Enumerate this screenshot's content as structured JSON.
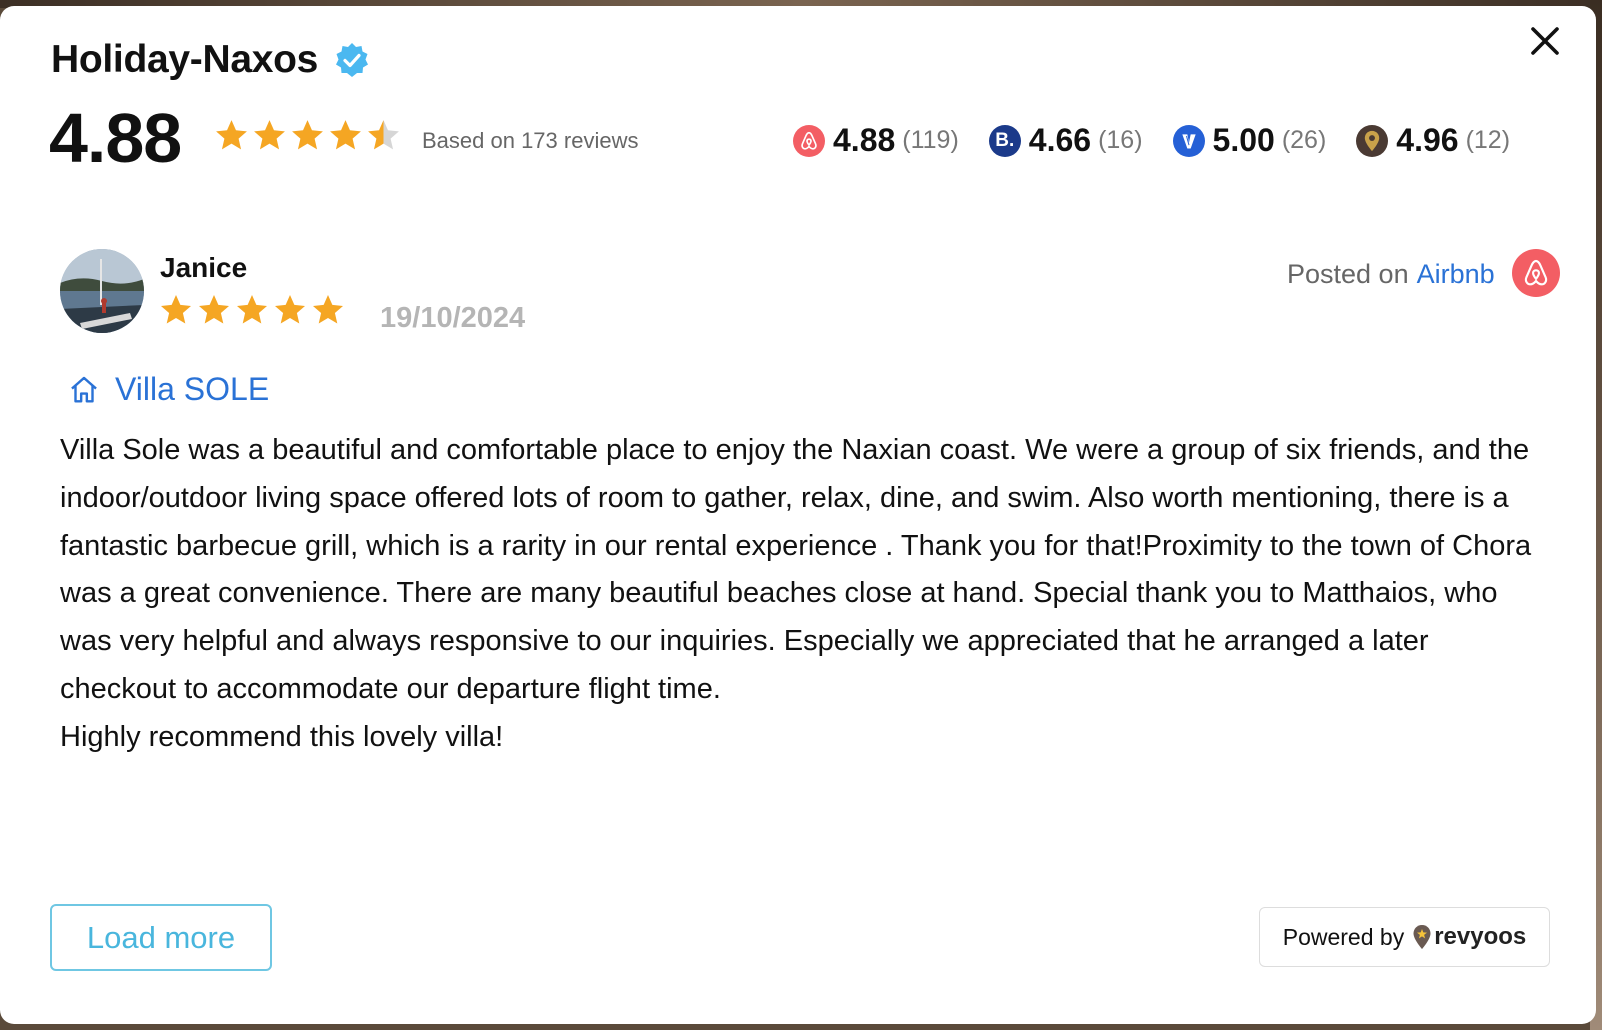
{
  "widget": {
    "title": "Holiday-Naxos",
    "verified_icon": "verified-badge-icon",
    "close_icon": "close-icon",
    "overall_rating": "4.88",
    "overall_stars": 4.88,
    "based_on": "Based on 173 reviews"
  },
  "platforms": [
    {
      "name": "airbnb",
      "icon": "airbnb-icon",
      "score": "4.88",
      "count": "(119)",
      "color": "#f35e64"
    },
    {
      "name": "booking",
      "icon": "booking-icon",
      "score": "4.66",
      "count": "(16)",
      "color": "#1b3a8a"
    },
    {
      "name": "vrbo",
      "icon": "vrbo-icon",
      "score": "5.00",
      "count": "(26)",
      "color": "#2560d6"
    },
    {
      "name": "other",
      "icon": "location-pin-icon",
      "score": "4.96",
      "count": "(12)",
      "color": "#4a3a33"
    }
  ],
  "review": {
    "reviewer": "Janice",
    "stars": 5,
    "date": "19/10/2024",
    "posted_prefix": "Posted on",
    "posted_source": "Airbnb",
    "listing": "Villa SOLE",
    "text": "Villa Sole was a beautiful and comfortable place to enjoy the Naxian coast. We were a group of six friends, and the indoor/outdoor living space offered lots of room to gather, relax, dine, and swim. Also worth mentioning, there is a fantastic barbecue grill, which is a rarity in our rental experience . Thank you for that!Proximity to the town of Chora was a great convenience. There are many beautiful beaches close at hand. Special thank you to Matthaios, who was very helpful and always responsive to our inquiries. Especially we appreciated that he arranged a later checkout to accommodate our departure flight time.\nHighly recommend this lovely villa!"
  },
  "footer": {
    "load_more": "Load more",
    "powered_by": "Powered by",
    "brand": "revyoos"
  },
  "colors": {
    "star": "#f5a623",
    "link": "#2a72d6",
    "load_more": "#49b6dd",
    "verified": "#4bb8f0"
  }
}
